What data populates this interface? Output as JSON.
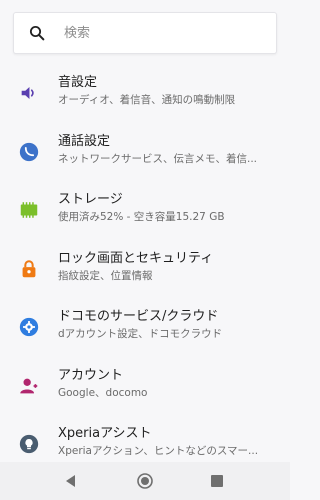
{
  "search": {
    "placeholder": "検索",
    "icon": "search-icon"
  },
  "settings": [
    {
      "title": "音設定",
      "subtitle": "オーディオ、着信音、通知の鳴動制限",
      "icon": "volume-icon",
      "color": "#5a3fb0"
    },
    {
      "title": "通話設定",
      "subtitle": "ネットワークサービス、伝言メモ、着信...",
      "icon": "phone-icon",
      "color": "#3d72c9"
    },
    {
      "title": "ストレージ",
      "subtitle": "使用済み52% - 空き容量15.27 GB",
      "icon": "storage-icon",
      "color": "#7bbf2a"
    },
    {
      "title": "ロック画面とセキュリティ",
      "subtitle": "指紋設定、位置情報",
      "icon": "lock-icon",
      "color": "#ef7a13"
    },
    {
      "title": "ドコモのサービス/クラウド",
      "subtitle": "dアカウント設定、ドコモクラウド",
      "icon": "gear-icon",
      "color": "#2f7de0"
    },
    {
      "title": "アカウント",
      "subtitle": "Google、docomo",
      "icon": "account-icon",
      "color": "#b1266e"
    },
    {
      "title": "Xperiaアシスト",
      "subtitle": "Xperiaアクション、ヒントなどのスマー...",
      "icon": "bulb-icon",
      "color": "#4a5d70"
    }
  ],
  "navbar": {
    "back": "back-icon",
    "home": "home-icon",
    "recents": "recents-icon"
  }
}
